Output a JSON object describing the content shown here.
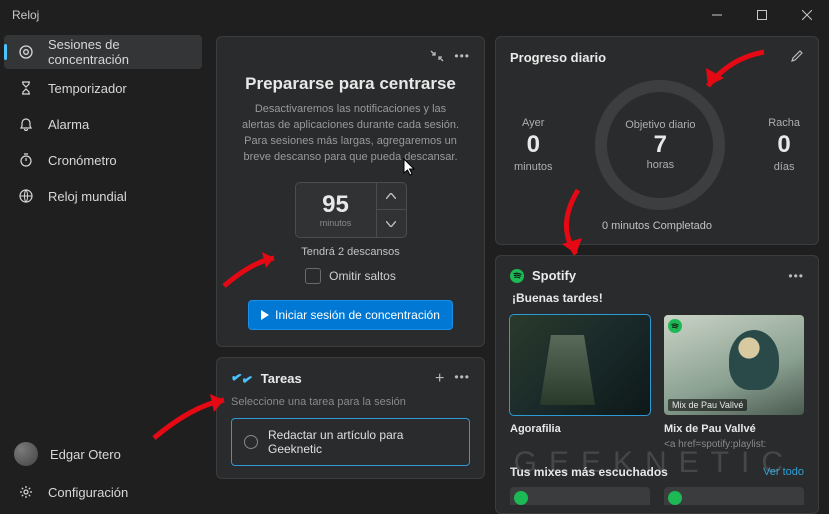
{
  "window": {
    "title": "Reloj"
  },
  "sidebar": {
    "items": [
      {
        "label": "Sesiones de concentración"
      },
      {
        "label": "Temporizador"
      },
      {
        "label": "Alarma"
      },
      {
        "label": "Cronómetro"
      },
      {
        "label": "Reloj mundial"
      }
    ],
    "user": "Edgar Otero",
    "settings": "Configuración"
  },
  "focus": {
    "heading": "Prepararse para centrarse",
    "subtitle": "Desactivaremos las notificaciones y las alertas de aplicaciones durante cada sesión. Para sesiones más largas, agregaremos un breve descanso para que pueda descansar.",
    "minutes_value": "95",
    "minutes_unit": "minutos",
    "breaks_info": "Tendrá 2 descansos",
    "skip_label": "Omitir saltos",
    "start_label": "Iniciar sesión de concentración"
  },
  "tasks": {
    "title": "Tareas",
    "hint": "Seleccione una tarea para la sesión",
    "items": [
      {
        "label": "Redactar un artículo para Geeknetic"
      }
    ]
  },
  "progress": {
    "title": "Progreso diario",
    "yesterday": {
      "label": "Ayer",
      "value": "0",
      "unit": "minutos"
    },
    "goal": {
      "label": "Objetivo diario",
      "value": "7",
      "unit": "horas"
    },
    "streak": {
      "label": "Racha",
      "value": "0",
      "unit": "días"
    },
    "completed": "0 minutos Completado"
  },
  "spotify": {
    "brand": "Spotify",
    "greeting": "¡Buenas tardes!",
    "items": [
      {
        "name": "Agorafilia",
        "sub": ""
      },
      {
        "name": "Mix de Pau Vallvé",
        "sub": "<a href=spotify:playlist:",
        "badge": "Mix de Pau Vallvé"
      }
    ],
    "mixes_title": "Tus mixes más escuchados",
    "see_all": "Ver todo"
  },
  "watermark": "GEEKNETIC"
}
